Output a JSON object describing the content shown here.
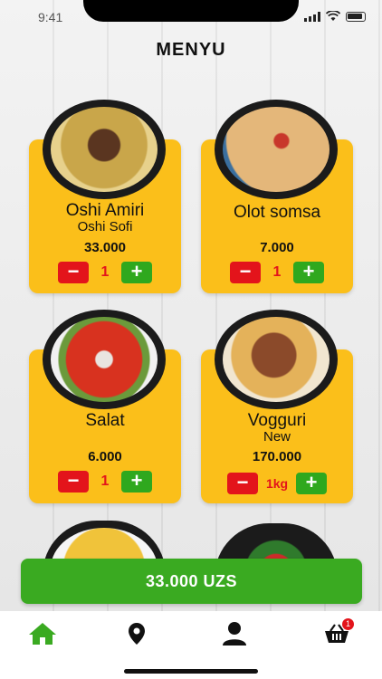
{
  "status": {
    "time": "9:41"
  },
  "title": "MENYU",
  "items": [
    {
      "name": "Oshi Amiri",
      "subtitle": "Oshi Sofi",
      "price": "33.000",
      "qty": "1",
      "minus": "−",
      "plus": "+"
    },
    {
      "name": "Olot somsa",
      "subtitle": "",
      "price": "7.000",
      "qty": "1",
      "minus": "−",
      "plus": "+"
    },
    {
      "name": "Salat",
      "subtitle": "",
      "price": "6.000",
      "qty": "1",
      "minus": "−",
      "plus": "+"
    },
    {
      "name": "Vogguri",
      "subtitle": "New",
      "price": "170.000",
      "qty": "1kg",
      "minus": "−",
      "plus": "+"
    }
  ],
  "total_button": {
    "label": "33.000 UZS"
  },
  "tabbar": {
    "tabs": [
      "home-icon",
      "location-pin-icon",
      "profile-icon",
      "basket-icon"
    ],
    "cart_badge": "1",
    "active_color": "#3aaa21"
  },
  "colors": {
    "card": "#fbbf1a",
    "minus": "#e3141b",
    "plus": "#2fa81e",
    "accent": "#3aaa21"
  }
}
